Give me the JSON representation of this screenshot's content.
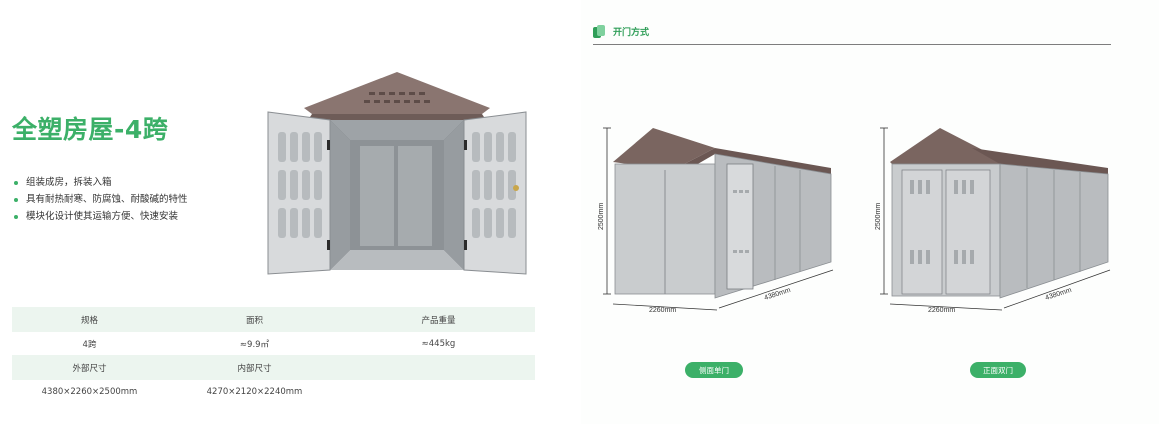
{
  "left": {
    "title": "全塑房屋-4跨",
    "features": [
      "组装成房，拆装入箱",
      "具有耐热耐寒、防腐蚀、耐酸碱的特性",
      "模块化设计使其运输方便、快速安装"
    ],
    "table": {
      "row1_headers": [
        "规格",
        "面积",
        "产品重量"
      ],
      "row1_values": [
        "4跨",
        "≈9.9㎡",
        "≈445kg"
      ],
      "row2_headers": [
        "外部尺寸",
        "内部尺寸"
      ],
      "row2_values": [
        "4380×2260×2500mm",
        "4270×2120×2240mm"
      ]
    }
  },
  "right": {
    "section_title": "开门方式",
    "dims": {
      "height": "2500mm",
      "width": "2260mm",
      "length": "4380mm"
    },
    "options": [
      "侧面单门",
      "正面双门"
    ]
  },
  "colors": {
    "accent": "#3cb068",
    "roof": "#7a6560",
    "wall": "#c9ccce"
  }
}
